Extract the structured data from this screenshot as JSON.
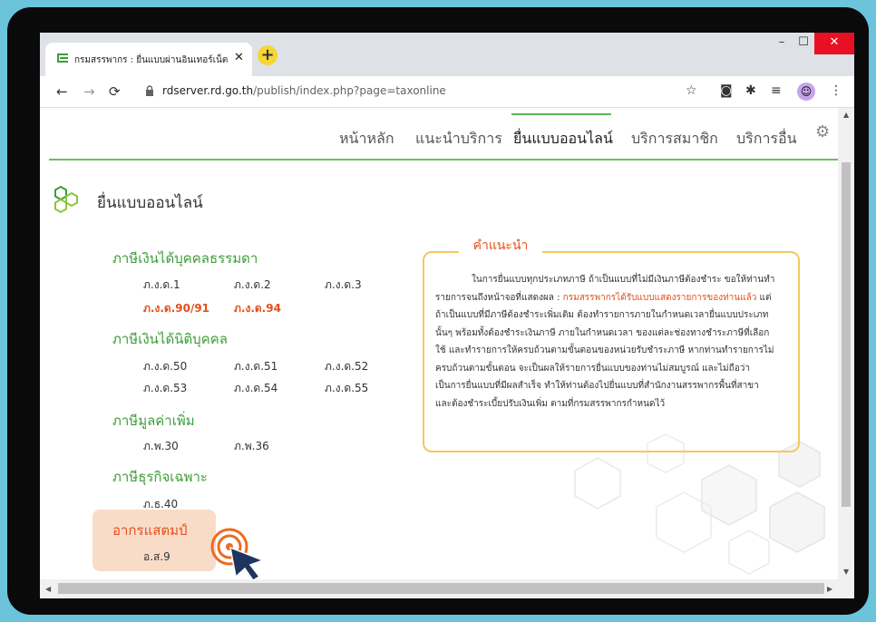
{
  "browser": {
    "tab_title": "กรมสรรพากร : ยื่นแบบผ่านอินเทอร์เน็ต",
    "tab_close": "✕",
    "new_tab": "+",
    "url_host": "rdserver.rd.go.th",
    "url_path": "/publish/index.php?page=taxonline",
    "controls": {
      "minimize": "–",
      "maximize": "☐",
      "close": "✕"
    },
    "nav_icons": [
      "back-arrow-icon",
      "forward-arrow-icon",
      "reload-icon"
    ],
    "extension_icons": [
      "star-icon",
      "camera-icon",
      "puzzle-icon",
      "reading-list-icon",
      "profile-icon",
      "more-icon"
    ]
  },
  "site_nav": {
    "items": [
      "หน้าหลัก",
      "แนะนำบริการ",
      "ยื่นแบบออนไลน์",
      "บริการสมาชิก",
      "บริการอื่น"
    ],
    "active": "ยื่นแบบออนไลน์"
  },
  "section_title": "ยื่นแบบออนไลน์",
  "categories": {
    "personal": {
      "title": "ภาษีเงินได้บุคคลธรรมดา",
      "items": [
        "ภ.ง.ด.1",
        "ภ.ง.ด.2",
        "ภ.ง.ด.3",
        "ภ.ง.ด.90/91",
        "ภ.ง.ด.94"
      ]
    },
    "corporate": {
      "title": "ภาษีเงินได้นิติบุคคล",
      "items": [
        "ภ.ง.ด.50",
        "ภ.ง.ด.51",
        "ภ.ง.ด.52",
        "ภ.ง.ด.53",
        "ภ.ง.ด.54",
        "ภ.ง.ด.55"
      ]
    },
    "vat": {
      "title": "ภาษีมูลค่าเพิ่ม",
      "items": [
        "ภ.พ.30",
        "ภ.พ.36"
      ]
    },
    "sbt": {
      "title": "ภาษีธุรกิจเฉพาะ",
      "items": [
        "ภ.ธ.40"
      ]
    },
    "stamp": {
      "title": "อากรแสตมป์",
      "items": [
        "อ.ส.9"
      ]
    }
  },
  "advice": {
    "title": "คำแนะนำ",
    "line1": "ในการยื่นแบบทุกประเภทภาษี ถ้าเป็นแบบที่ไม่มีเงินภาษีต้องชำระ ขอให้ท่านทำ",
    "line2_pre": "รายการจนถึงหน้าจอที่แสดงผล : ",
    "line2_highlight": "กรมสรรพากรได้รับแบบแสดงรายการของท่านแล้ว",
    "line2_post": " แต่",
    "line3": "ถ้าเป็นแบบที่มีภาษีต้องชำระเพิ่มเติม ต้องทำรายการภายในกำหนดเวลายื่นแบบประเภท",
    "line4": "นั้นๆ พร้อมทั้งต้องชำระเงินภาษี ภายในกำหนดเวลา ของแต่ละช่องทางชำระภาษีที่เลือก",
    "line5": "ใช้ และทำรายการให้ครบถ้วนตามขั้นตอนของหน่วยรับชำระภาษี หากท่านทำรายการไม่",
    "line6": "ครบถ้วนตามขั้นตอน จะเป็นผลให้รายการยื่นแบบของท่านไม่สมบูรณ์ และไม่ถือว่า",
    "line7": "เป็นการยื่นแบบที่มีผลสำเร็จ ทำให้ท่านต้องไปยื่นแบบที่สำนักงานสรรพากรพื้นที่สาขา",
    "line8": "และต้องชำระเบี้ยปรับเงินเพิ่ม ตามที่กรมสรรพากรกำหนดไว้"
  },
  "colors": {
    "accent_green": "#3e9d3a",
    "accent_orange": "#e2501a",
    "box_border": "#f4c75e",
    "stamp_bg": "#f9dcc8"
  }
}
